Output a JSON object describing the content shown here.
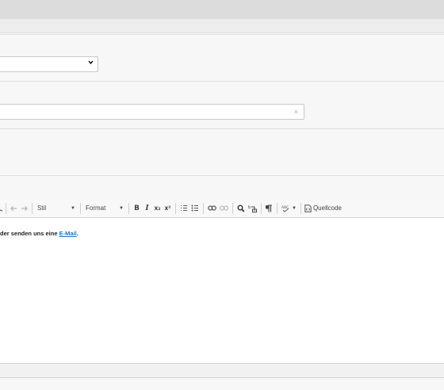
{
  "editor": {
    "toolbar": {
      "style_combo": "Stil",
      "format_combo": "Format",
      "bold": "B",
      "italic": "I",
      "subscript": "x₂",
      "superscript": "x²",
      "source_label": "Quellcode"
    },
    "content": {
      "text_before": "der senden uns eine ",
      "link_text": "E-Mail",
      "text_after": "."
    }
  },
  "fields": {
    "text_clear": "×"
  },
  "colors": {
    "link": "#1f74c4",
    "border": "#c8c8c8",
    "panel": "#f7f7f7"
  }
}
